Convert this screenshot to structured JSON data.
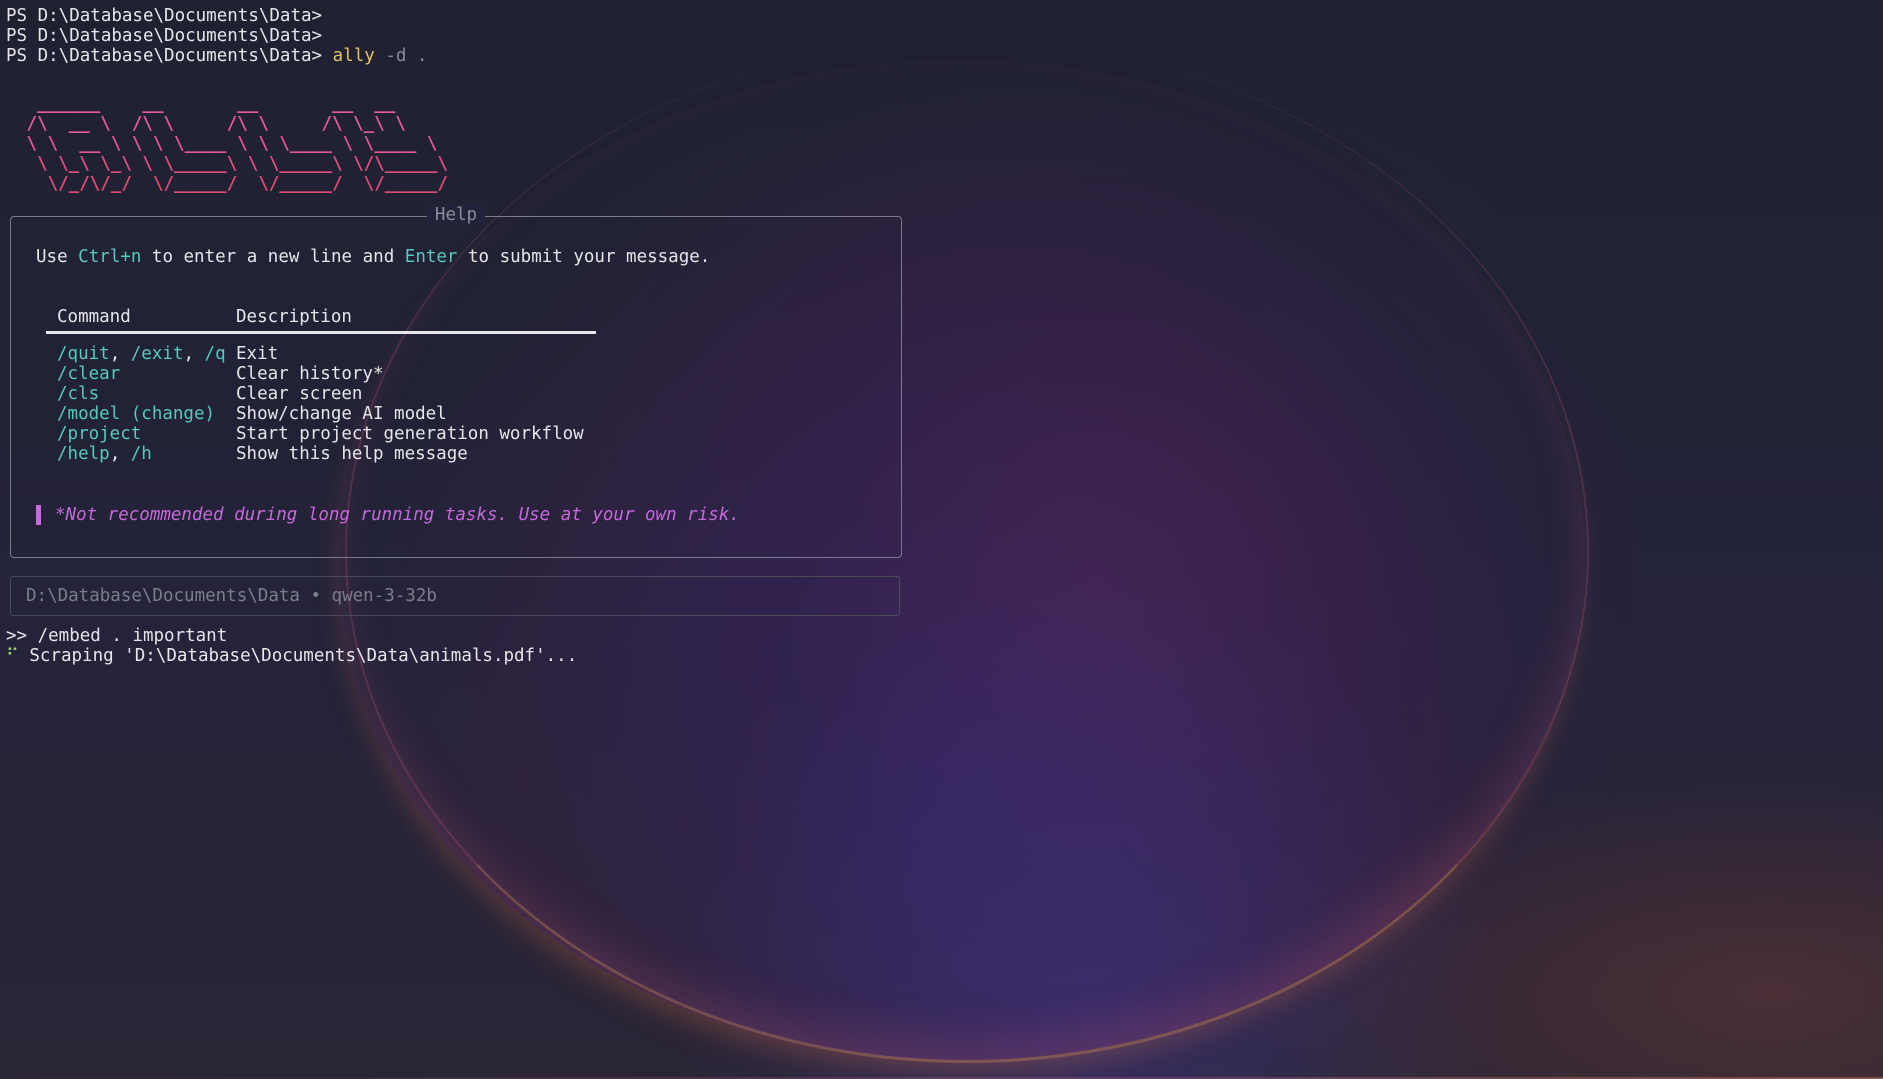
{
  "prompt_lines": [
    {
      "prefix": "PS D:\\Database\\Documents\\Data>",
      "cmd": "",
      "args": ""
    },
    {
      "prefix": "PS D:\\Database\\Documents\\Data>",
      "cmd": "",
      "args": ""
    },
    {
      "prefix": "PS D:\\Database\\Documents\\Data>",
      "cmd": "ally",
      "args": " -d ."
    }
  ],
  "logo": [
    "  ______    __       __       __  __",
    " /\\  __ \\  /\\ \\     /\\ \\     /\\ \\_\\ \\",
    " \\ \\  __ \\ \\ \\ \\____ \\ \\ \\____ \\ \\____ \\",
    "  \\ \\_\\ \\_\\ \\ \\_____\\ \\ \\_____\\ \\/\\_____\\",
    "   \\/_/\\/_/  \\/_____/  \\/_____/  \\/_____/"
  ],
  "help": {
    "title": "Help",
    "text_pre": "Use ",
    "key1": "Ctrl+n",
    "text_mid": " to enter a new line and ",
    "key2": "Enter",
    "text_post": " to submit your message.",
    "header_command": "Command",
    "header_description": "Description",
    "rows": [
      {
        "cmd": [
          "/quit",
          "/exit",
          "/q"
        ],
        "desc": "Exit"
      },
      {
        "cmd": [
          "/clear"
        ],
        "desc": "Clear history*"
      },
      {
        "cmd": [
          "/cls"
        ],
        "desc": "Clear screen"
      },
      {
        "cmd": [
          "/model (change)"
        ],
        "desc": "Show/change AI model"
      },
      {
        "cmd": [
          "/project"
        ],
        "desc": "Start project generation workflow"
      },
      {
        "cmd": [
          "/help",
          "/h"
        ],
        "desc": "Show this help message"
      }
    ],
    "note": "*Not recommended during long running tasks. Use at your own risk."
  },
  "status": {
    "path": "D:\\Database\\Documents\\Data",
    "separator": " • ",
    "model": "qwen-3-32b"
  },
  "input_line": ">> /embed . important",
  "progress_line": {
    "spinner": "⠋",
    "text": " Scraping 'D:\\Database\\Documents\\Data\\animals.pdf'..."
  },
  "colors": {
    "accent_cyan": "#56c9c1",
    "accent_yellow": "#e8c26a",
    "accent_magenta": "#c46ad8",
    "logo_pink": "#e458a0"
  }
}
